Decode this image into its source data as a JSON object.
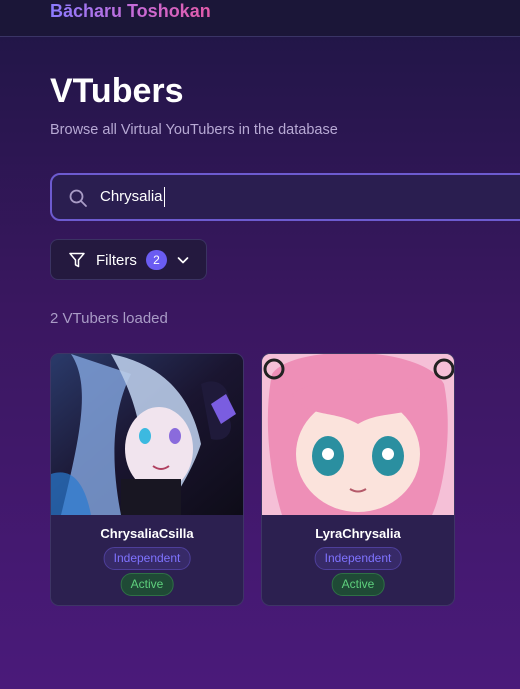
{
  "app": {
    "brand": "Bācharu Toshokan"
  },
  "page": {
    "title": "VTubers",
    "subtitle": "Browse all Virtual YouTubers in the database"
  },
  "search": {
    "value": "Chrysalia",
    "icon": "search-icon"
  },
  "filters": {
    "label": "Filters",
    "count": "2"
  },
  "results": {
    "count_text": "2 VTubers loaded"
  },
  "vtubers": [
    {
      "name": "ChrysaliaCsilla",
      "affiliation": "Independent",
      "status": "Active"
    },
    {
      "name": "LyraChrysalia",
      "affiliation": "Independent",
      "status": "Active"
    }
  ],
  "colors": {
    "accent": "#6b5cf2",
    "active_green": "#5ed07d",
    "independent_purple": "#7f73ff"
  }
}
